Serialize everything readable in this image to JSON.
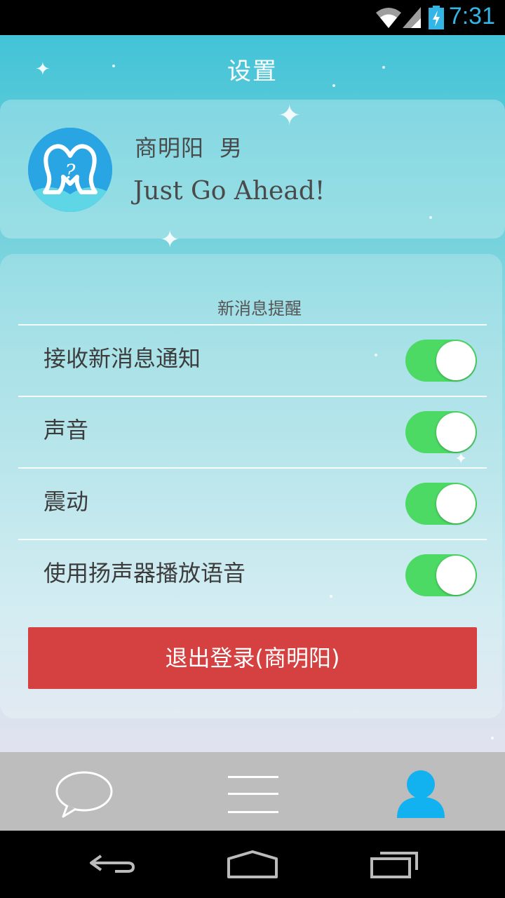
{
  "status_bar": {
    "time": "7:31",
    "icons": [
      "wifi-icon",
      "signal-icon",
      "battery-charging-icon"
    ],
    "accent_color": "#33b5e5"
  },
  "header": {
    "title": "设置"
  },
  "profile": {
    "name": "商明阳",
    "gender": "男",
    "motto": "Just Go Ahead!",
    "avatar_icon": "heart-question-logo"
  },
  "settings": {
    "section_title": "新消息提醒",
    "items": [
      {
        "label": "接收新消息通知",
        "enabled": true
      },
      {
        "label": "声音",
        "enabled": true
      },
      {
        "label": "震动",
        "enabled": true
      },
      {
        "label": "使用扬声器播放语音",
        "enabled": true
      }
    ],
    "toggle_on_color": "#4cd964"
  },
  "logout": {
    "label": "退出登录(商明阳)",
    "color": "#d54040"
  },
  "tab_bar": {
    "tabs": [
      {
        "icon": "chat-bubble-icon",
        "active": false
      },
      {
        "icon": "menu-icon",
        "active": false
      },
      {
        "icon": "person-icon",
        "active": true
      }
    ],
    "active_color": "#12b1ef"
  },
  "nav_bar": {
    "buttons": [
      "back-icon",
      "home-icon",
      "recents-icon"
    ]
  }
}
